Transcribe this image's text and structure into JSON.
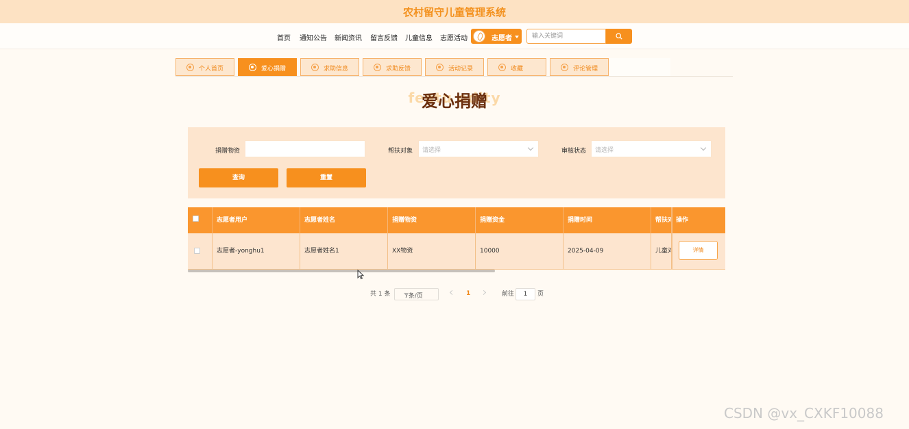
{
  "app": {
    "title": "农村留守儿童管理系统"
  },
  "nav": {
    "items": [
      "首页",
      "通知公告",
      "新闻资讯",
      "留言反馈",
      "儿童信息",
      "志愿活动"
    ],
    "user_label": "志愿者",
    "search_placeholder": "输入关键词"
  },
  "tabs": [
    {
      "label": "个人首页",
      "active": false
    },
    {
      "label": "爱心捐赠",
      "active": true
    },
    {
      "label": "求助信息",
      "active": false
    },
    {
      "label": "求助反馈",
      "active": false
    },
    {
      "label": "活动记录",
      "active": false
    },
    {
      "label": "收藏",
      "active": false
    },
    {
      "label": "评论管理",
      "active": false
    }
  ],
  "page": {
    "title": "爱心捐赠",
    "title_bg": "featu odity"
  },
  "filter": {
    "field1_label": "捐赠物资",
    "field2_label": "帮扶对象",
    "field2_placeholder": "请选择",
    "field3_label": "审核状态",
    "field3_placeholder": "请选择",
    "query_label": "查询",
    "reset_label": "重置"
  },
  "table": {
    "headers": [
      "志愿者用户",
      "志愿者姓名",
      "捐赠物资",
      "捐赠资金",
      "捐赠时间",
      "帮扶对",
      "操作"
    ],
    "rows": [
      [
        "志愿者-yonghu1",
        "志愿者姓名1",
        "XX物资",
        "10000",
        "2025-04-09",
        "儿童对"
      ]
    ],
    "action_label": "详情"
  },
  "pagination": {
    "total_text": "共 1 条",
    "page_size": "7条/页",
    "current_page": "1",
    "goto_prefix": "前往",
    "goto_value": "1",
    "goto_suffix": "页"
  },
  "watermark": "CSDN @vx_CXKF10088",
  "colors": {
    "accent": "#f7901e",
    "header_bg": "#fde2c3",
    "panel_bg": "#fde5ce"
  }
}
